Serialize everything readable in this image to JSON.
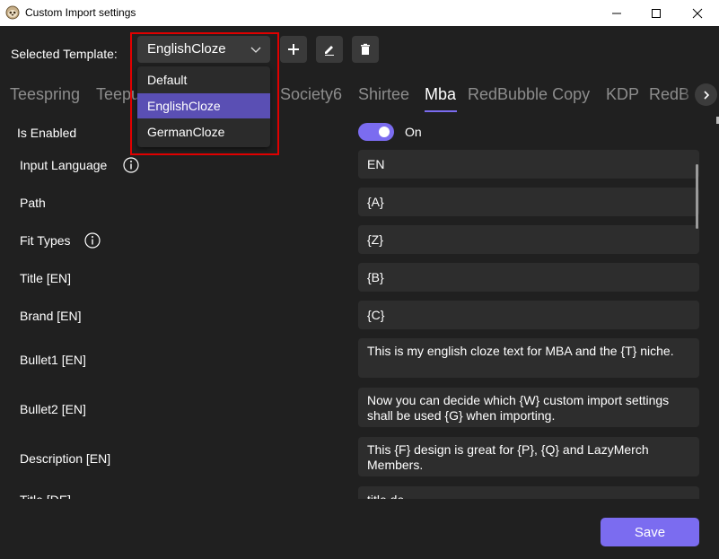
{
  "window": {
    "title": "Custom Import settings",
    "app_icon": "sloth-face-icon"
  },
  "template": {
    "label": "Selected Template:",
    "selected": "EnglishCloze",
    "options": [
      "Default",
      "EnglishCloze",
      "GermanCloze"
    ],
    "add_icon": "plus-icon",
    "edit_icon": "pencil-icon",
    "delete_icon": "trash-icon"
  },
  "tabs": {
    "items": [
      "Teespring",
      "Teepu",
      "Society6",
      "Shirtee",
      "Mba",
      "RedBubble Copy",
      "KDP",
      "RedB"
    ],
    "active": "Mba"
  },
  "fields": {
    "is_enabled": {
      "label": "Is Enabled",
      "value": "On",
      "toggled": true
    },
    "input_language": {
      "label": "Input Language",
      "value": "EN"
    },
    "path": {
      "label": "Path",
      "value": "{A}"
    },
    "fit_types": {
      "label": "Fit Types",
      "value": "{Z}"
    },
    "title_en": {
      "label": "Title [EN]",
      "value": "{B}"
    },
    "brand_en": {
      "label": "Brand [EN]",
      "value": "{C}"
    },
    "bullet1_en": {
      "label": "Bullet1 [EN]",
      "value": "This is my english cloze text for MBA and the {T} niche."
    },
    "bullet2_en": {
      "label": "Bullet2 [EN]",
      "value": "Now you can decide which {W} custom import settings shall be used {G} when importing."
    },
    "description_en": {
      "label": "Description [EN]",
      "value": "This {F} design is great for {P}, {Q} and LazyMerch Members."
    },
    "title_de": {
      "label": "Title [DE]",
      "value": "title de"
    }
  },
  "actions": {
    "save_label": "Save"
  },
  "colors": {
    "accent": "#7b6cf0",
    "background": "#202020",
    "field": "#2d2d2d",
    "highlight": "#e00000"
  }
}
